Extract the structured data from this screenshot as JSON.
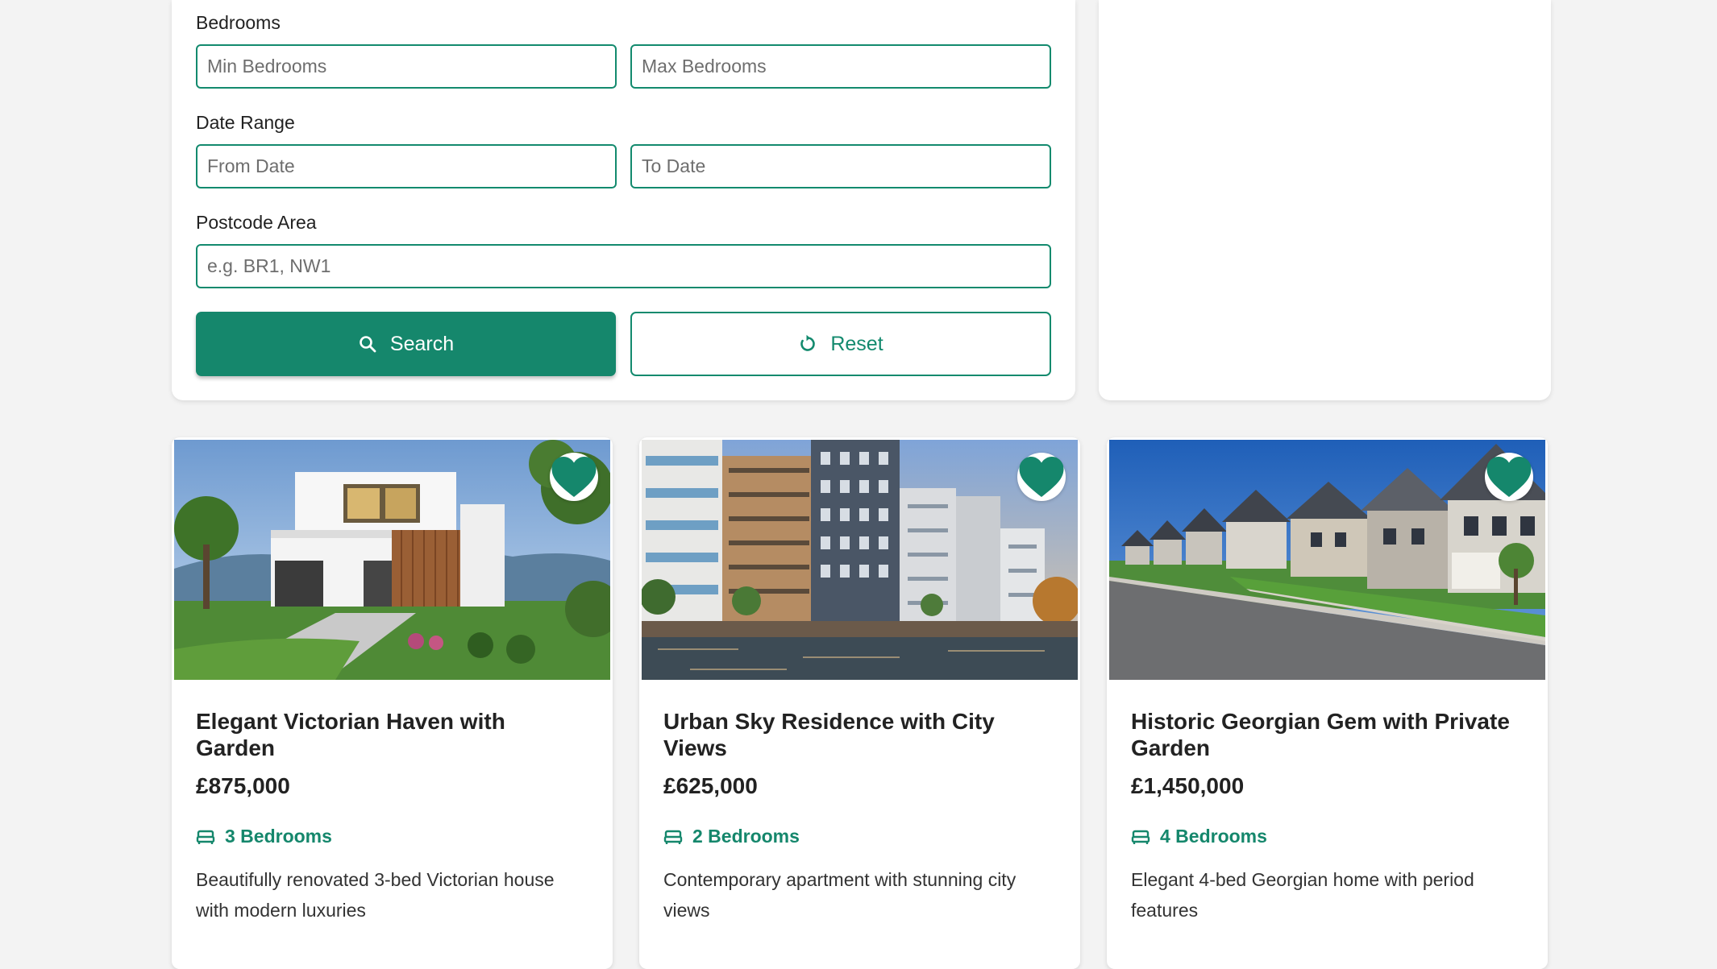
{
  "filters": {
    "bedrooms": {
      "label": "Bedrooms",
      "min_placeholder": "Min Bedrooms",
      "max_placeholder": "Max Bedrooms"
    },
    "date_range": {
      "label": "Date Range",
      "from_placeholder": "From Date",
      "to_placeholder": "To Date"
    },
    "postcode": {
      "label": "Postcode Area",
      "placeholder": "e.g. BR1, NW1"
    },
    "search_label": "Search",
    "reset_label": "Reset"
  },
  "listings": [
    {
      "title": "Elegant Victorian Haven with Garden",
      "price": "£875,000",
      "bedrooms": "3 Bedrooms",
      "description": "Beautifully renovated 3-bed Victorian house with modern luxuries"
    },
    {
      "title": "Urban Sky Residence with City Views",
      "price": "£625,000",
      "bedrooms": "2 Bedrooms",
      "description": "Contemporary apartment with stunning city views"
    },
    {
      "title": "Historic Georgian Gem with Private Garden",
      "price": "£1,450,000",
      "bedrooms": "4 Bedrooms",
      "description": "Elegant 4-bed Georgian home with period features"
    }
  ],
  "icons": {
    "search": "search-icon",
    "reset": "refresh-icon",
    "favorite": "heart-icon",
    "bed": "bed-icon"
  },
  "colors": {
    "accent": "#15876c",
    "background": "#f3f3f3",
    "card": "#ffffff"
  }
}
